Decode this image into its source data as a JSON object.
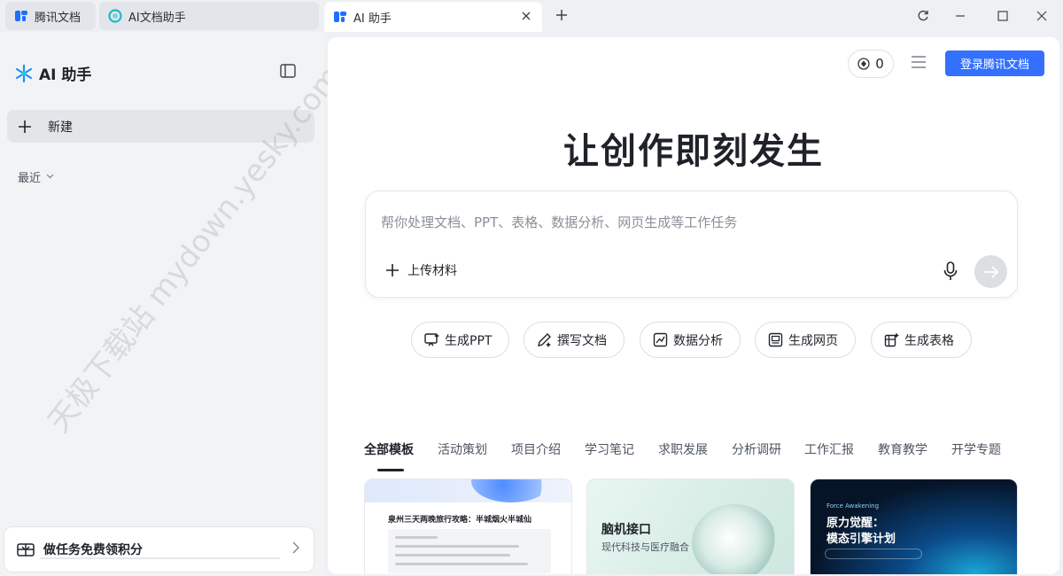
{
  "tabs": [
    {
      "label": "腾讯文档"
    },
    {
      "label": "AI文档助手"
    },
    {
      "label": "AI 助手"
    }
  ],
  "sidebar": {
    "brand": "AI 助手",
    "new_label": "新建",
    "recent_label": "最近",
    "task_label": "做任务免费领积分"
  },
  "watermark": "天极下载站 mydown.yesky.com",
  "header": {
    "credits": "0",
    "login_label": "登录腾讯文档"
  },
  "hero_title": "让创作即刻发生",
  "prompt": {
    "placeholder": "帮你处理文档、PPT、表格、数据分析、网页生成等工作任务",
    "upload_label": "上传材料"
  },
  "actions": [
    {
      "label": "生成PPT",
      "icon": "ppt-icon"
    },
    {
      "label": "撰写文档",
      "icon": "pen-icon"
    },
    {
      "label": "数据分析",
      "icon": "chart-icon"
    },
    {
      "label": "生成网页",
      "icon": "webpage-icon"
    },
    {
      "label": "生成表格",
      "icon": "table-icon"
    }
  ],
  "categories": [
    "全部模板",
    "活动策划",
    "项目介绍",
    "学习笔记",
    "求职发展",
    "分析调研",
    "工作汇报",
    "教育教学",
    "开学专题"
  ],
  "templates": [
    {
      "title": "泉州三天两晚旅行攻略：半城烟火半城仙"
    },
    {
      "title": "脑机接口",
      "subtitle": "现代科技与医疗融合"
    },
    {
      "tag": "Force Awakening",
      "title_line1": "原力觉醒：",
      "title_line2": "模态引擎计划"
    }
  ],
  "colors": {
    "accent": "#3370ff",
    "sidebar_bg": "#f2f3f5"
  }
}
